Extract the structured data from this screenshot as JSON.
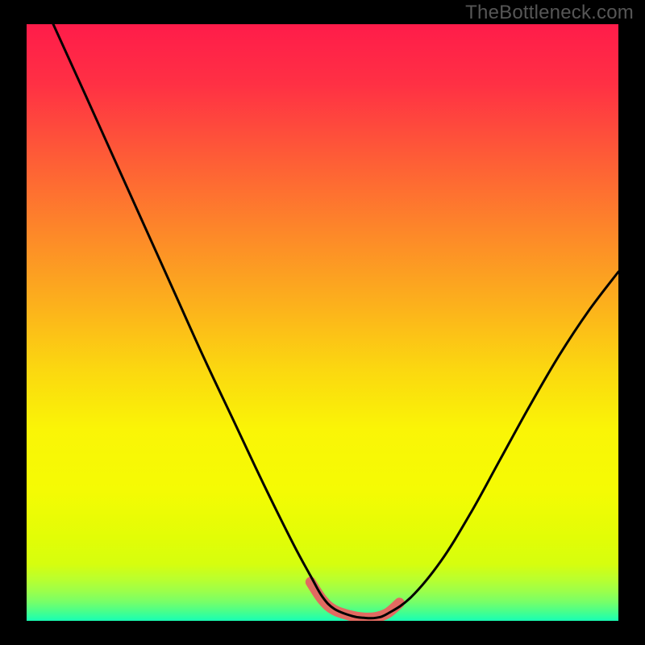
{
  "watermark": "TheBottleneck.com",
  "colors": {
    "black": "#000000",
    "curve": "#010101",
    "bottom_highlight": "#e26a61",
    "gradient_stops": [
      {
        "offset": 0.0,
        "color": "#ff1c4a"
      },
      {
        "offset": 0.1,
        "color": "#ff3044"
      },
      {
        "offset": 0.22,
        "color": "#fe5b37"
      },
      {
        "offset": 0.35,
        "color": "#fd8829"
      },
      {
        "offset": 0.48,
        "color": "#fcb41b"
      },
      {
        "offset": 0.58,
        "color": "#fbd810"
      },
      {
        "offset": 0.68,
        "color": "#faf506"
      },
      {
        "offset": 0.78,
        "color": "#f5fb04"
      },
      {
        "offset": 0.86,
        "color": "#e2fd06"
      },
      {
        "offset": 0.905,
        "color": "#d6fe0e"
      },
      {
        "offset": 0.93,
        "color": "#baff2e"
      },
      {
        "offset": 0.95,
        "color": "#9cff4a"
      },
      {
        "offset": 0.968,
        "color": "#78ff68"
      },
      {
        "offset": 0.985,
        "color": "#46ff8d"
      },
      {
        "offset": 1.0,
        "color": "#18ffb5"
      }
    ]
  },
  "chart_data": {
    "type": "line",
    "title": "",
    "xlabel": "",
    "ylabel": "",
    "xlim": [
      0,
      100
    ],
    "ylim": [
      0,
      100
    ],
    "note": "Axes are unlabeled; values expressed as percentage of plot area (0 = left/bottom, 100 = right/top).",
    "series": [
      {
        "name": "bottleneck-curve",
        "x": [
          4.5,
          10,
          15,
          20,
          25,
          30,
          35,
          40,
          45,
          48,
          50,
          52,
          55,
          57,
          59,
          61,
          65,
          70,
          75,
          80,
          85,
          90,
          95,
          100
        ],
        "y": [
          100,
          88,
          77,
          66,
          55,
          44,
          33.5,
          23,
          13,
          7.5,
          4,
          2,
          0.8,
          0.5,
          0.5,
          1.2,
          4,
          10,
          18,
          27,
          36,
          44.5,
          52,
          58.5
        ]
      }
    ],
    "highlight_segment": {
      "name": "optimal-zone",
      "x": [
        48,
        50,
        52,
        55,
        57,
        59,
        61,
        63
      ],
      "y": [
        6.5,
        3.5,
        1.8,
        0.8,
        0.5,
        0.6,
        1.3,
        3.0
      ],
      "color": "#e26a61"
    }
  }
}
